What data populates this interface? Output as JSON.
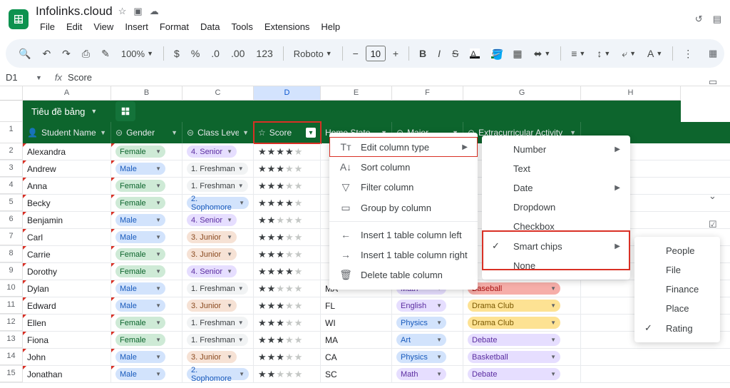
{
  "doc": {
    "name": "Infolinks.cloud"
  },
  "menus": [
    "File",
    "Edit",
    "View",
    "Insert",
    "Format",
    "Data",
    "Tools",
    "Extensions",
    "Help"
  ],
  "toolbar": {
    "zoom": "100%",
    "font": "Roboto",
    "size": "10"
  },
  "namebox": {
    "ref": "D1",
    "formula": "Score"
  },
  "cols": [
    "A",
    "B",
    "C",
    "D",
    "E",
    "F",
    "G",
    "H"
  ],
  "table_title": "Tiêu đề bảng",
  "headers": {
    "student": "Student Name",
    "gender": "Gender",
    "class": "Class Level",
    "score": "Score",
    "home": "Home State",
    "major": "Major",
    "extra": "Extracurricular Activity"
  },
  "rows": [
    {
      "n": "2",
      "name": "Alexandra",
      "gender": "Female",
      "class": "4. Senior",
      "stars": 4,
      "state": "",
      "major": "",
      "extra": ""
    },
    {
      "n": "3",
      "name": "Andrew",
      "gender": "Male",
      "class": "1. Freshman",
      "stars": 3,
      "state": "",
      "major": "",
      "extra": ""
    },
    {
      "n": "4",
      "name": "Anna",
      "gender": "Female",
      "class": "1. Freshman",
      "stars": 3,
      "state": "",
      "major": "",
      "extra": ""
    },
    {
      "n": "5",
      "name": "Becky",
      "gender": "Female",
      "class": "2. Sophomore",
      "stars": 4,
      "state": "",
      "major": "",
      "extra": ""
    },
    {
      "n": "6",
      "name": "Benjamin",
      "gender": "Male",
      "class": "4. Senior",
      "stars": 2,
      "state": "",
      "major": "",
      "extra": ""
    },
    {
      "n": "7",
      "name": "Carl",
      "gender": "Male",
      "class": "3. Junior",
      "stars": 3,
      "state": "",
      "major": "",
      "extra": ""
    },
    {
      "n": "8",
      "name": "Carrie",
      "gender": "Female",
      "class": "3. Junior",
      "stars": 3,
      "state": "",
      "major": "",
      "extra": ""
    },
    {
      "n": "9",
      "name": "Dorothy",
      "gender": "Female",
      "class": "4. Senior",
      "stars": 4,
      "state": "",
      "major": "",
      "extra": ""
    },
    {
      "n": "10",
      "name": "Dylan",
      "gender": "Male",
      "class": "1. Freshman",
      "stars": 2,
      "state": "MA",
      "major": "Math",
      "extra": "Baseball"
    },
    {
      "n": "11",
      "name": "Edward",
      "gender": "Male",
      "class": "3. Junior",
      "stars": 3,
      "state": "FL",
      "major": "English",
      "extra": "Drama Club"
    },
    {
      "n": "12",
      "name": "Ellen",
      "gender": "Female",
      "class": "1. Freshman",
      "stars": 3,
      "state": "WI",
      "major": "Physics",
      "extra": "Drama Club"
    },
    {
      "n": "13",
      "name": "Fiona",
      "gender": "Female",
      "class": "1. Freshman",
      "stars": 3,
      "state": "MA",
      "major": "Art",
      "extra": "Debate"
    },
    {
      "n": "14",
      "name": "John",
      "gender": "Male",
      "class": "3. Junior",
      "stars": 3,
      "state": "CA",
      "major": "Physics",
      "extra": "Basketball"
    },
    {
      "n": "15",
      "name": "Jonathan",
      "gender": "Male",
      "class": "2. Sophomore",
      "stars": 2,
      "state": "SC",
      "major": "Math",
      "extra": "Debate"
    }
  ],
  "context1": {
    "edit": "Edit column type",
    "sort": "Sort column",
    "filter": "Filter column",
    "group": "Group by column",
    "ins_left": "Insert 1 table column left",
    "ins_right": "Insert 1 table column right",
    "delete": "Delete table column"
  },
  "context2": {
    "number": "Number",
    "text": "Text",
    "date": "Date",
    "dropdown": "Dropdown",
    "checkbox": "Checkbox",
    "smart": "Smart chips",
    "none": "None"
  },
  "context3": {
    "people": "People",
    "file": "File",
    "finance": "Finance",
    "place": "Place",
    "rating": "Rating"
  }
}
